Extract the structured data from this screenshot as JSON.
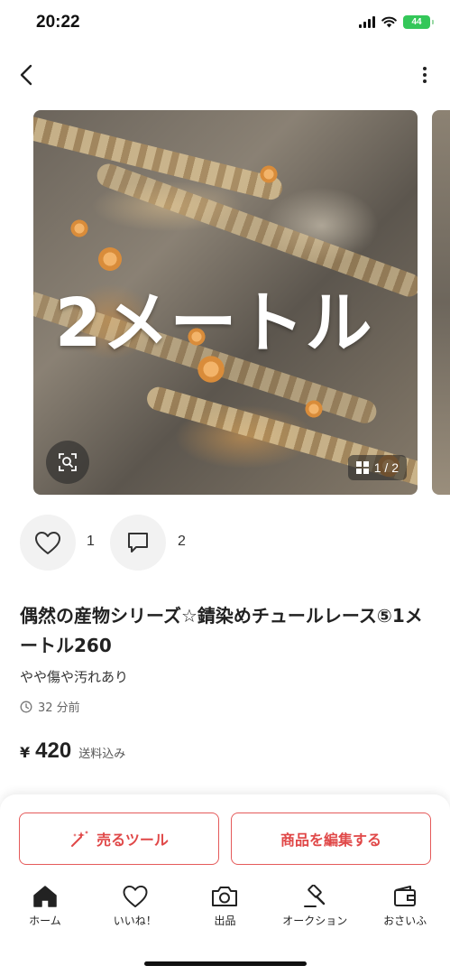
{
  "status_bar": {
    "time": "20:22",
    "battery": "44"
  },
  "product": {
    "image_overlay_text": "2メートル",
    "image_counter": "1 / 2",
    "likes": "1",
    "comments": "2",
    "title": "偶然の産物シリーズ☆錆染めチュールレース⑤1メートル260",
    "condition": "やや傷や汚れあり",
    "posted": "32 分前",
    "price_symbol": "¥",
    "price": "420",
    "shipping_note": "送料込み"
  },
  "actions": {
    "sell_tool_label": "売るツール",
    "edit_label": "商品を編集する"
  },
  "tabbar": {
    "items": [
      {
        "label": "ホーム",
        "icon": "home-icon"
      },
      {
        "label": "いいね！",
        "icon": "heart-icon"
      },
      {
        "label": "出品",
        "icon": "camera-icon"
      },
      {
        "label": "オークション",
        "icon": "gavel-icon"
      },
      {
        "label": "おさいふ",
        "icon": "wallet-icon"
      }
    ]
  },
  "colors": {
    "accent": "#e04848",
    "battery": "#34c759"
  }
}
